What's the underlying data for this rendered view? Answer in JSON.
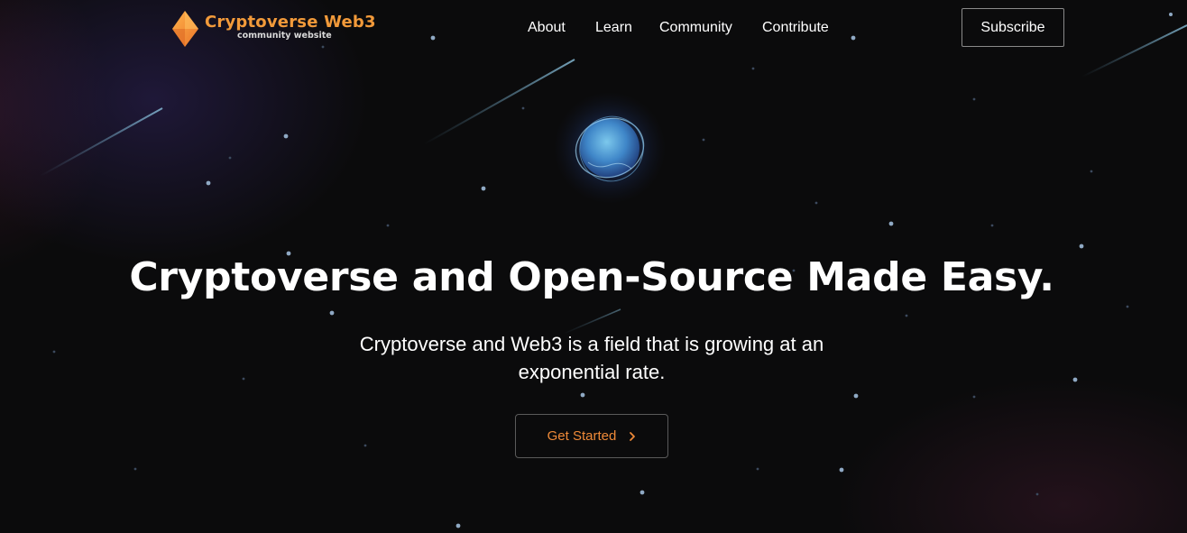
{
  "brand": {
    "title": "Cryptoverse Web3",
    "subtitle": "community website",
    "logo_icon": "diamond-icon",
    "accent_color": "#f29a3a"
  },
  "nav": {
    "items": [
      {
        "label": "About"
      },
      {
        "label": "Learn"
      },
      {
        "label": "Community"
      },
      {
        "label": "Contribute"
      }
    ],
    "subscribe_label": "Subscribe"
  },
  "hero": {
    "headline": "Cryptoverse and Open-Source Made Easy.",
    "subtitle": "Cryptoverse and Web3 is a field that is growing at an exponential rate.",
    "cta_label": "Get Started",
    "cta_icon": "chevron-right-icon",
    "cta_color": "#ef8a38",
    "planet_icon": "glowing-planet-icon"
  }
}
